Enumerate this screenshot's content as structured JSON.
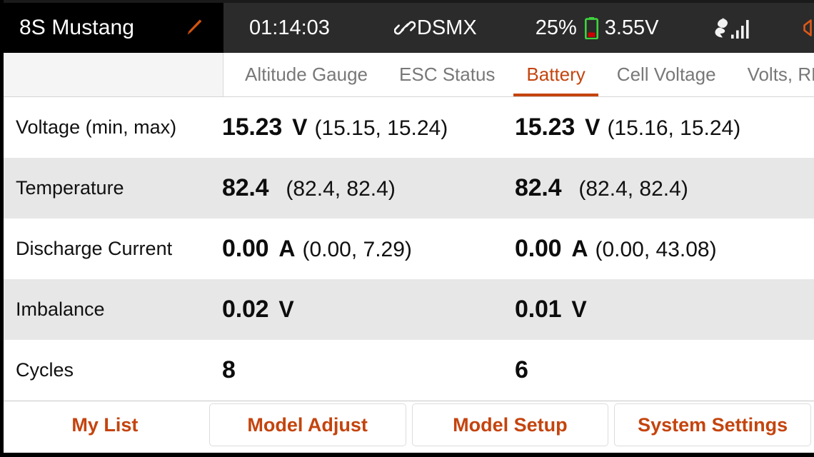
{
  "topbar": {
    "model_name": "8S Mustang",
    "edit_icon": "pencil-icon",
    "timer": "01:14:03",
    "protocol": "DSMX",
    "protocol_icon": "link-icon",
    "battery_percent": "25%",
    "battery_icon": "battery-icon",
    "battery_voltage": "3.55V",
    "signal_icon": "signal-bars-icon",
    "volume_icon": "speaker-icon",
    "colors": {
      "title_bg": "#000000",
      "status_bg": "#2b2b2b",
      "accent": "#c4440e",
      "battery_outline": "#3fd43f",
      "battery_fill": "#cc0000"
    }
  },
  "tabs": [
    {
      "label": "Altitude Gauge",
      "active": false
    },
    {
      "label": "ESC Status",
      "active": false
    },
    {
      "label": "Battery",
      "active": true
    },
    {
      "label": "Cell Voltage",
      "active": false
    },
    {
      "label": "Volts, RPM, T",
      "active": false
    }
  ],
  "table": {
    "rows": [
      {
        "label": "Voltage (min, max)",
        "left": {
          "value": "15.23",
          "unit": "V",
          "range": "(15.15, 15.24)"
        },
        "right": {
          "value": "15.23",
          "unit": "V",
          "range": "(15.16, 15.24)"
        }
      },
      {
        "label": "Temperature",
        "left": {
          "value": "82.4",
          "unit": "",
          "range": "(82.4, 82.4)"
        },
        "right": {
          "value": "82.4",
          "unit": "",
          "range": "(82.4, 82.4)"
        }
      },
      {
        "label": "Discharge Current",
        "left": {
          "value": "0.00",
          "unit": "A",
          "range": "(0.00, 7.29)"
        },
        "right": {
          "value": "0.00",
          "unit": "A",
          "range": "(0.00, 43.08)"
        }
      },
      {
        "label": "Imbalance",
        "left": {
          "value": "0.02",
          "unit": "V",
          "range": ""
        },
        "right": {
          "value": "0.01",
          "unit": "V",
          "range": ""
        }
      },
      {
        "label": "Cycles",
        "left": {
          "value": "8",
          "unit": "",
          "range": ""
        },
        "right": {
          "value": "6",
          "unit": "",
          "range": ""
        }
      }
    ]
  },
  "bottom_nav": [
    {
      "label": "My List"
    },
    {
      "label": "Model Adjust"
    },
    {
      "label": "Model Setup"
    },
    {
      "label": "System Settings"
    }
  ]
}
